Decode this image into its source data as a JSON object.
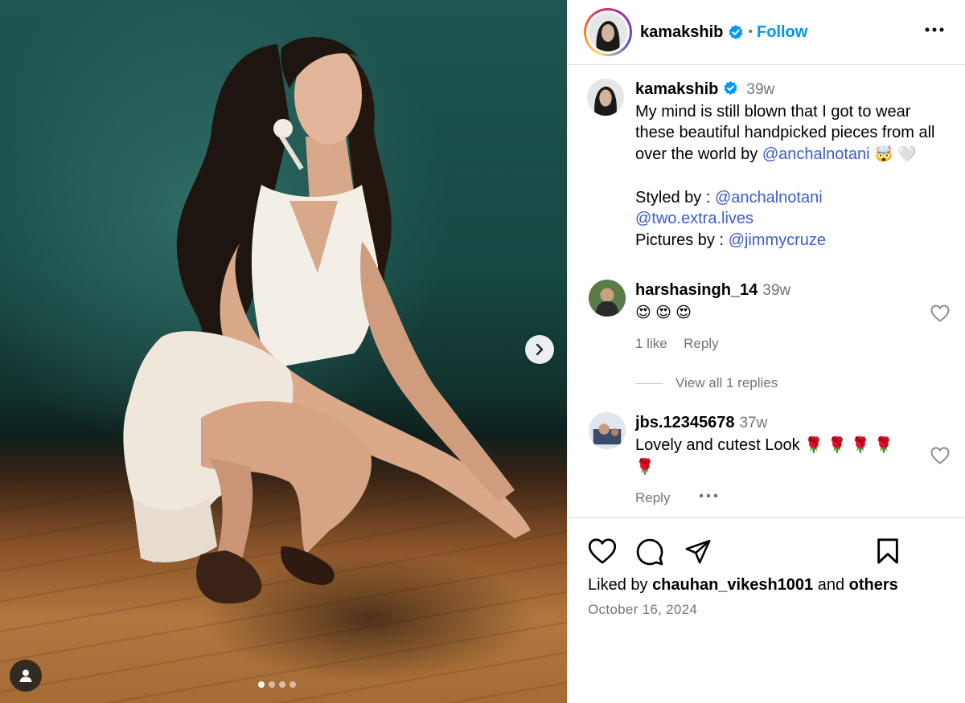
{
  "post": {
    "author": "kamakshib",
    "follow_label": "Follow",
    "separator": "•",
    "carousel_count": 4,
    "carousel_active": 0
  },
  "caption": {
    "username": "kamakshib",
    "time": "39w",
    "line1": "My mind is still blown that I got to wear these beautiful handpicked pieces from all over the world by ",
    "mention1": "@anchalnotani",
    "emoji1": "🤯 🤍",
    "styled_label": "Styled by : ",
    "mention2": "@anchalnotani",
    "mention3": "@two.extra.lives",
    "pictures_label": "Pictures by : ",
    "mention4": "@jimmycruze"
  },
  "comments": [
    {
      "username": "harshasingh_14",
      "time": "39w",
      "text": "😍 😍 😍",
      "likes": "1 like",
      "reply_label": "Reply",
      "view_replies": "View all 1 replies"
    },
    {
      "username": "jbs.12345678",
      "time": "37w",
      "text": "Lovely and cutest Look ",
      "emoji": "🌹 🌹 🌹 🌹 🌹",
      "reply_label": "Reply"
    }
  ],
  "footer": {
    "liked_prefix": "Liked by ",
    "liked_user": "chauhan_vikesh1001",
    "liked_and": " and ",
    "liked_others": "others",
    "date": "October 16, 2024"
  },
  "colors": {
    "accent": "#0095f6",
    "mention": "#3b5cd0",
    "muted": "#737373",
    "verified": "#0095f6"
  }
}
